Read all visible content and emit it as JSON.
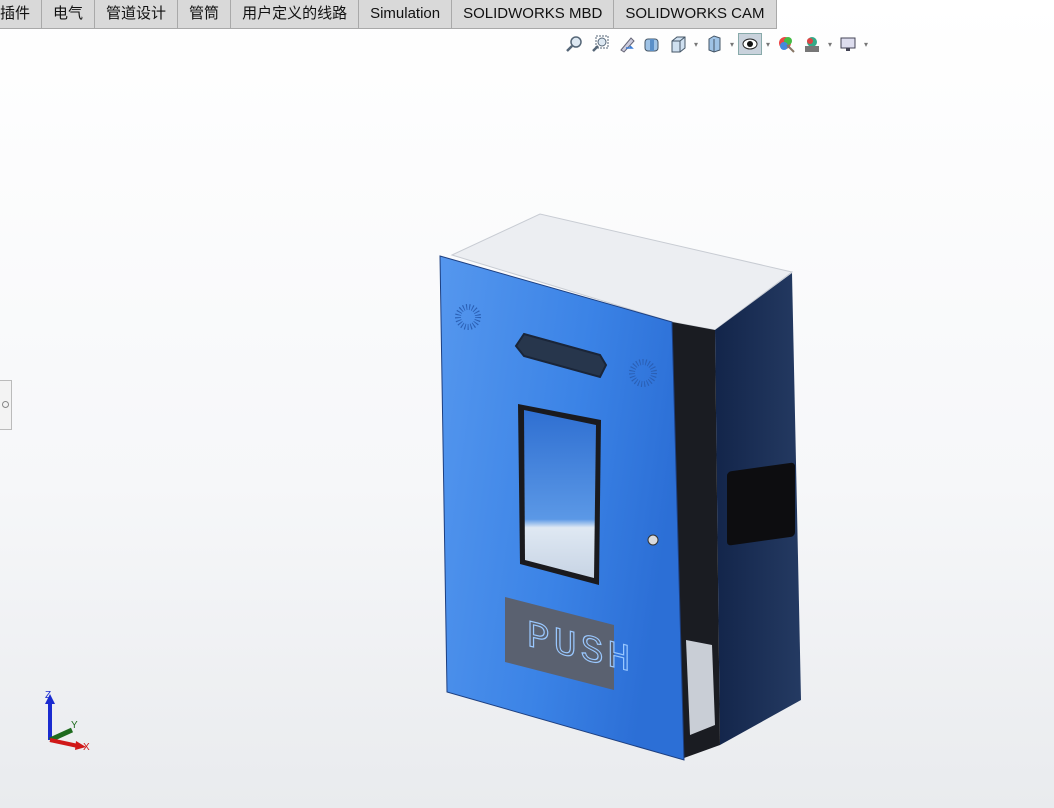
{
  "tabs": [
    "插件",
    "电气",
    "管道设计",
    "管筒",
    "用户定义的线路",
    "Simulation",
    "SOLIDWORKS MBD",
    "SOLIDWORKS CAM"
  ],
  "toolbar": [
    "zoom-to-fit-icon",
    "zoom-to-area-icon",
    "previous-view-icon",
    "section-view-icon",
    "view-orientation-icon",
    "display-style-icon",
    "hide-show-items-icon",
    "edit-appearance-icon",
    "apply-scene-icon",
    "view-settings-icon"
  ],
  "model": {
    "panel_text": "PUSH"
  },
  "triad": {
    "x": "X",
    "y": "Y",
    "z": "Z"
  },
  "colors": {
    "door": "#3f86e6",
    "side": "#1c2f52",
    "top": "#e8eaee"
  }
}
